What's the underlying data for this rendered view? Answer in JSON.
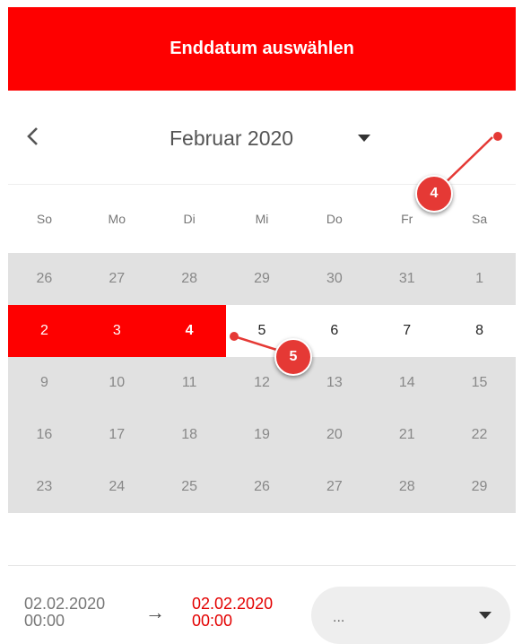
{
  "header": {
    "title": "Enddatum auswählen"
  },
  "calendar": {
    "month_label": "Februar 2020",
    "weekdays": [
      "So",
      "Mo",
      "Di",
      "Mi",
      "Do",
      "Fr",
      "Sa"
    ],
    "weeks": [
      [
        "26",
        "27",
        "28",
        "29",
        "30",
        "31",
        "1"
      ],
      [
        "2",
        "3",
        "4",
        "5",
        "6",
        "7",
        "8"
      ],
      [
        "9",
        "10",
        "11",
        "12",
        "13",
        "14",
        "15"
      ],
      [
        "16",
        "17",
        "18",
        "19",
        "20",
        "21",
        "22"
      ],
      [
        "23",
        "24",
        "25",
        "26",
        "27",
        "28",
        "29"
      ]
    ]
  },
  "footer": {
    "start_date": "02.02.2020",
    "start_time": "00:00",
    "arrow": "→",
    "end_date": "02.02.2020",
    "end_time": "00:00",
    "select_value": "..."
  },
  "annotations": {
    "badge_4": "4",
    "badge_5": "5"
  },
  "colors": {
    "accent": "#fe0000",
    "badge": "#e53935",
    "disabled_bg": "#e1e1e1"
  },
  "icons": {
    "prev": "chevron-left-icon",
    "dropdown": "caret-down-icon",
    "next": "dot-icon"
  }
}
